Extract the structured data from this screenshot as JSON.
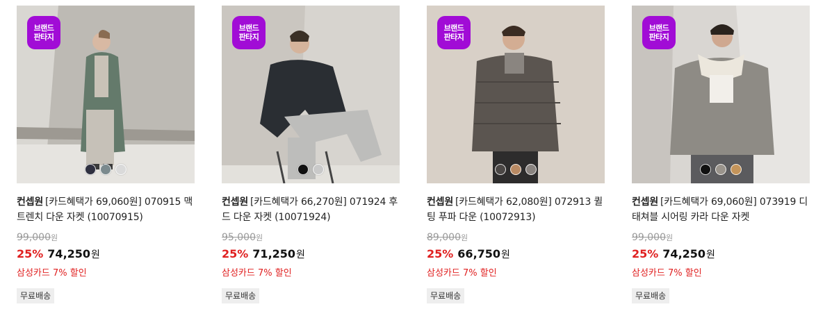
{
  "badge": {
    "line1": "브랜드",
    "line2": "판타지",
    "color": "#a10cd6"
  },
  "products": [
    {
      "brand": "컨셉원",
      "name": "[카드혜택가 69,060원] 070915 맥 트렌치 다운 자켓 (10070915)",
      "original_price": "99,000",
      "won": "원",
      "discount": "25%",
      "price": "74,250",
      "benefit": "삼성카드 7% 할인",
      "shipping": "무료배송",
      "swatches": [
        "#2f3040",
        "#7b8a8e",
        "#dadada"
      ],
      "image": "man in long khaki-green down coat against stone wall"
    },
    {
      "brand": "컨셉원",
      "name": "[카드혜택가 66,270원] 071924 후드 다운 자켓 (10071924)",
      "original_price": "95,000",
      "won": "원",
      "discount": "25%",
      "price": "71,250",
      "benefit": "삼성카드 7% 할인",
      "shipping": "무료배송",
      "swatches": [
        "#111111",
        "#c9c9c9"
      ],
      "image": "man seated on chair wearing black hooded down jacket"
    },
    {
      "brand": "컨셉원",
      "name": "[카드혜택가 62,080원] 072913 퀼팅 푸파 다운 (10072913)",
      "original_price": "89,000",
      "won": "원",
      "discount": "25%",
      "price": "66,750",
      "benefit": "삼성카드 7% 할인",
      "shipping": "무료배송",
      "swatches": [
        "#4b4745",
        "#b98a63",
        "#8a8480"
      ],
      "image": "man in brown-gray quilted puffer jacket"
    },
    {
      "brand": "컨셉원",
      "name": "[카드혜택가 69,060원] 073919 디태쳐블 시어링 카라 다운 자켓",
      "original_price": "99,000",
      "won": "원",
      "discount": "25%",
      "price": "74,250",
      "benefit": "삼성카드 7% 할인",
      "shipping": "무료배송",
      "swatches": [
        "#111111",
        "#9a948c",
        "#c4945a"
      ],
      "image": "man in gray jacket with shearling collar"
    }
  ]
}
